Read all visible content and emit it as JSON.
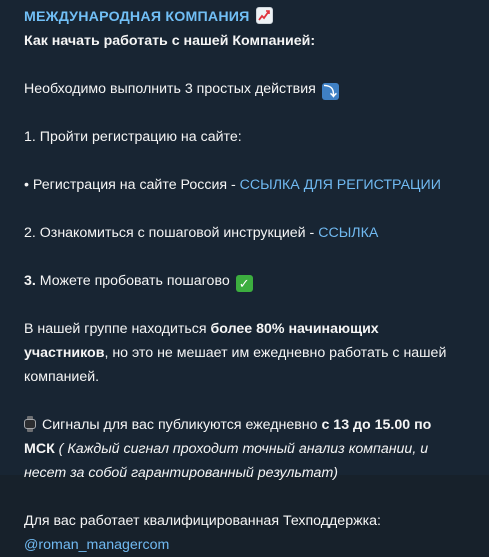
{
  "message": {
    "title": "МЕЖДУНАРОДНАЯ КОМПАНИЯ",
    "title_icon": "chart-increasing-icon",
    "heading": "Как начать работать с нашей Компанией:",
    "intro": "Необходимо выполнить 3 простых действия",
    "intro_icon": "arrow-right-down-icon",
    "step1": "1. Пройти регистрацию на сайте:",
    "reg_prefix": "• Регистрация на сайте Россия - ",
    "reg_link": "ССЫЛКА ДЛЯ РЕГИСТРАЦИИ",
    "step2_prefix": "2. Ознакомиться с пошаговой инструкцией - ",
    "step2_link": "ССЫЛКА",
    "step3_num": "3.",
    "step3_text": " Можете пробовать пошагово",
    "step3_icon": "check-mark-icon",
    "group_text_1": "В нашей группе находиться ",
    "group_bold_1": "более 80% начинающих",
    "group_bold_2": "участников",
    "group_text_2": ", но это не мешает им ежедневно работать с нашей",
    "group_text_3": "компанией.",
    "signals_icon": "watch-icon",
    "signals_text": "Сигналы для вас публикуются ежедневно ",
    "signals_bold_1": "с 13 до 15.00 по",
    "signals_bold_2": "МСК",
    "signals_italic_1": " ( Каждый сигнал проходит точный анализ компании, и",
    "signals_italic_2": "несет за собой гарантированный результат)",
    "support_text": "Для вас работает квалифицированная Техподдержка:",
    "support_link": "@roman_managercom"
  },
  "colors": {
    "background": "#182533",
    "text": "#f5f5f5",
    "title": "#71bff6",
    "link": "#71baf2"
  }
}
